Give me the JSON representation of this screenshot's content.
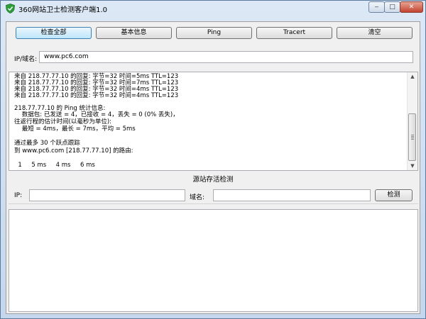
{
  "window": {
    "title": "360网站卫士检测客户端1.0",
    "controls": {
      "minimize": "‒",
      "maximize": "□",
      "close": "✕"
    }
  },
  "toolbar": {
    "buttons": [
      "检查全部",
      "基本信息",
      "Ping",
      "Tracert",
      "清空"
    ]
  },
  "host": {
    "label": "IP/域名:",
    "value": "www.pc6.com"
  },
  "output": {
    "lines": [
      "来自 218.77.77.10 的回复: 字节=32 时间=5ms TTL=123",
      "来自 218.77.77.10 的回复: 字节=32 时间=7ms TTL=123",
      "来自 218.77.77.10 的回复: 字节=32 时间=4ms TTL=123",
      "来自 218.77.77.10 的回复: 字节=32 时间=4ms TTL=123",
      "",
      "218.77.77.10 的 Ping 统计信息:",
      "    数据包: 已发送 = 4，已接收 = 4，丢失 = 0 (0% 丢失)，",
      "往返行程的估计时间(以毫秒为单位):",
      "    最短 = 4ms，最长 = 7ms，平均 = 5ms",
      "",
      "通过最多 30 个跃点跟踪",
      "到 www.pc6.com [218.77.77.10] 的路由:",
      "",
      "  1     5 ms     4 ms     6 ms"
    ]
  },
  "origin_check": {
    "title": "源站存活检测",
    "ip_label": "IP:",
    "ip_value": "",
    "domain_label": "域名:",
    "domain_value": "",
    "check_button": "检测"
  }
}
